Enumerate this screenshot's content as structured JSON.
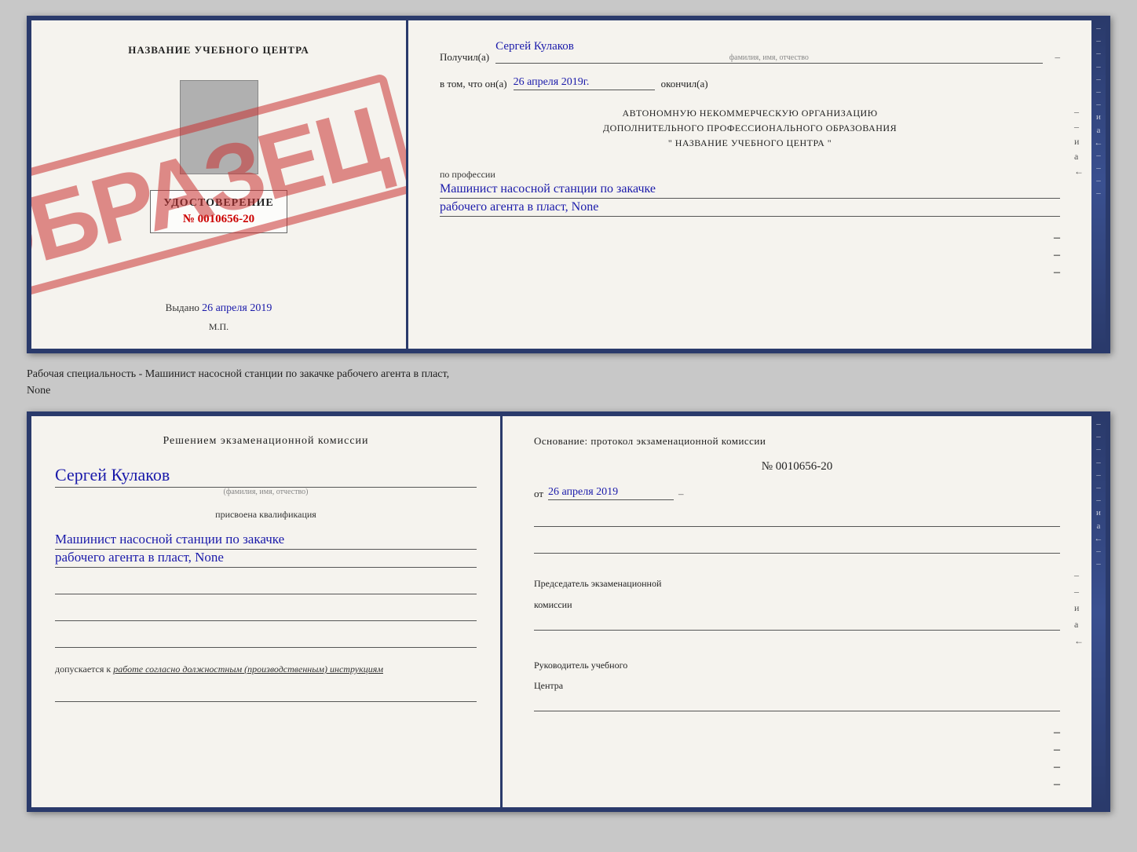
{
  "doc_top": {
    "left": {
      "title": "НАЗВАНИЕ УЧЕБНОГО ЦЕНТРА",
      "stamp": "ОБРАЗЕЦ",
      "udostoverenie_label": "УДОСТОВЕРЕНИЕ",
      "udostoverenie_num": "№ 0010656-20",
      "vydano_label": "Выдано",
      "vydano_date": "26 апреля 2019",
      "mp_label": "М.П."
    },
    "right": {
      "poluchil_label": "Получил(a)",
      "poluchil_value": "Сергей Кулаков",
      "familiya_hint": "фамилия, имя, отчество",
      "dash1": "–",
      "vtom_label": "в том, что он(а)",
      "vtom_value": "26 апреля 2019г.",
      "okonchil_label": "окончил(а)",
      "org_line1": "АВТОНОМНУЮ НЕКОММЕРЧЕСКУЮ ОРГАНИЗАЦИЮ",
      "org_line2": "ДОПОЛНИТЕЛЬНОГО ПРОФЕССИОНАЛЬНОГО ОБРАЗОВАНИЯ",
      "org_line3": "\"  НАЗВАНИЕ УЧЕБНОГО ЦЕНТРА  \"",
      "dash_i": "и",
      "dash_a": "а",
      "po_professii_label": "по профессии",
      "profession_line1": "Машинист насосной станции по закачке",
      "profession_line2": "рабочего агента в пласт, None",
      "dashes": [
        "–",
        "–",
        "–",
        "–"
      ]
    }
  },
  "separator": {
    "text_line1": "Рабочая специальность - Машинист насосной станции по закачке рабочего агента в пласт,",
    "text_line2": "None"
  },
  "doc_bottom": {
    "left": {
      "decision_title": "Решением экзаменационной комиссии",
      "name_value": "Сергей Кулаков",
      "name_hint": "(фамилия, имя, отчество)",
      "assigned_label": "присвоена квалификация",
      "qualification_line1": "Машинист насосной станции по закачке",
      "qualification_line2": "рабочего агента в пласт, None",
      "sig_line1": "",
      "sig_line2": "",
      "sig_line3": "",
      "dopuskaetsya_label": "допускается к",
      "dopuskaetsya_value": "работе согласно должностным (производственным) инструкциям",
      "sig_line_bottom": ""
    },
    "right": {
      "osnovaniye_title": "Основание: протокол экзаменационной комиссии",
      "protocol_num": "№ 0010656-20",
      "protocol_ot_label": "от",
      "protocol_date": "26 апреля 2019",
      "protocol_dash": "–",
      "predsedatel_line1": "Председатель экзаменационной",
      "predsedatel_line2": "комиссии",
      "predsedatel_dash1": "–",
      "predsedatel_dash2": "–",
      "i_label": "и",
      "a_label": "а",
      "left_arrow": "←",
      "rukovoditel_line1": "Руководитель учебного",
      "rukovoditel_line2": "Центра",
      "dashes": [
        "–",
        "–",
        "–",
        "–"
      ]
    }
  }
}
